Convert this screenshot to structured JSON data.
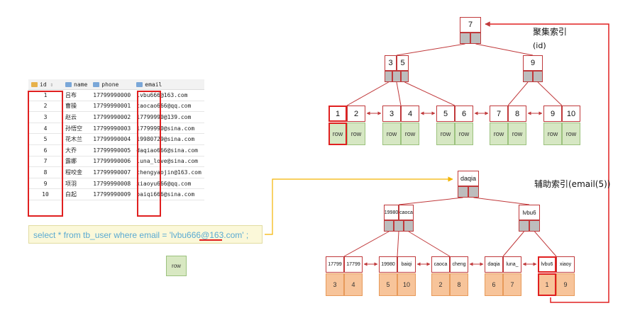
{
  "table": {
    "headers": [
      "id",
      "name",
      "phone",
      "email"
    ],
    "rows": [
      [
        "1",
        "吕布",
        "17799990000",
        "lvbu666@163.com"
      ],
      [
        "2",
        "曹操",
        "17799990001",
        "caocao666@qq.com"
      ],
      [
        "3",
        "赵云",
        "17799990002",
        "17799990@139.com"
      ],
      [
        "4",
        "孙悟空",
        "17799990003",
        "17799990@sina.com"
      ],
      [
        "5",
        "花木兰",
        "17799990004",
        "19980729@sina.com"
      ],
      [
        "6",
        "大乔",
        "17799990005",
        "daqiao666@sina.com"
      ],
      [
        "7",
        "露娜",
        "17799990006",
        "luna_love@sina.com"
      ],
      [
        "8",
        "程咬金",
        "17799990007",
        "chengyaojin@163.com"
      ],
      [
        "9",
        "项羽",
        "17799990008",
        "xiaoyu666@qq.com"
      ],
      [
        "10",
        "白起",
        "17799990009",
        "baiqi666@sina.com"
      ]
    ]
  },
  "sql": {
    "text": "select * from tb_user where email = 'lvbu666@163.com' ;"
  },
  "result_row": "row",
  "clustered": {
    "title": "聚集索引",
    "subtitle": "(id)",
    "root": [
      "7"
    ],
    "inner": [
      [
        "3",
        "5"
      ],
      [
        "9"
      ]
    ],
    "leaves": [
      [
        "1",
        "2"
      ],
      [
        "3",
        "4"
      ],
      [
        "5",
        "6"
      ],
      [
        "7",
        "8"
      ],
      [
        "9",
        "10"
      ]
    ],
    "leaf_value": "row"
  },
  "secondary": {
    "title": "辅助索引(email(5))",
    "root": [
      "daqia"
    ],
    "inner": [
      [
        "19980",
        "caoca"
      ],
      [
        "lvbu6"
      ]
    ],
    "leaves": [
      {
        "keys": [
          "17799",
          "17799"
        ],
        "vals": [
          "3",
          "4"
        ]
      },
      {
        "keys": [
          "19980",
          "baiqi"
        ],
        "vals": [
          "5",
          "10"
        ]
      },
      {
        "keys": [
          "caoca",
          "cheng"
        ],
        "vals": [
          "2",
          "8"
        ]
      },
      {
        "keys": [
          "daqia",
          "luna_"
        ],
        "vals": [
          "6",
          "7"
        ]
      },
      {
        "keys": [
          "lvbu6",
          "xiaoy"
        ],
        "vals": [
          "1",
          "9"
        ]
      }
    ]
  },
  "colors": {
    "accent_red": "#e02020",
    "node_border": "#c0393b",
    "pointer_gray": "#bdbdbd",
    "clustered_leaf": "#d6e7c3",
    "secondary_leaf": "#f7c49a",
    "connector_yellow": "#f3b400",
    "sql_text": "#5aaad2"
  }
}
